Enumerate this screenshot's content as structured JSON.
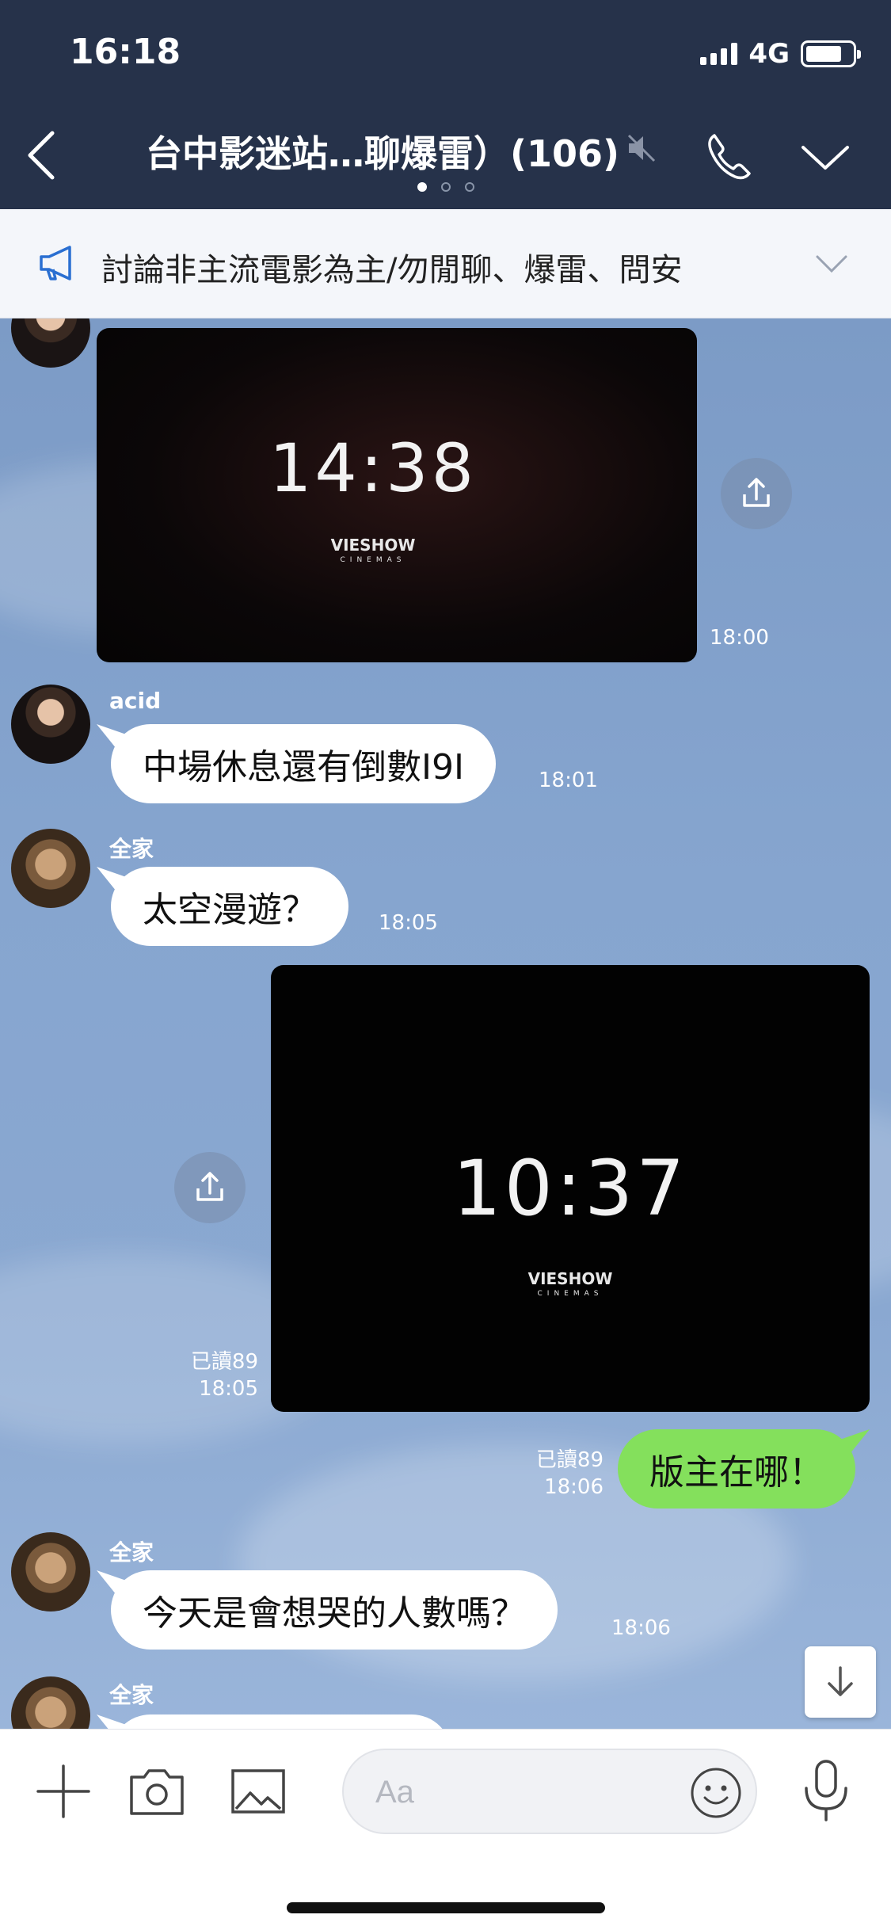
{
  "status_bar": {
    "time": "16:18",
    "network": "4G"
  },
  "header": {
    "title": "台中影迷站…聊爆雷）(106)"
  },
  "announcement": {
    "text": "討論非主流電影為主/勿閒聊、爆雷、問安"
  },
  "messages": [
    {
      "type": "image",
      "clock": "14:38",
      "brand": "VIESHOW",
      "brand_sub": "CINEMAS",
      "time": "18:00"
    },
    {
      "type": "text",
      "sender": "acid",
      "text": "中場休息還有倒數I9I",
      "time": "18:01"
    },
    {
      "type": "text",
      "sender": "全家",
      "text": "太空漫遊？",
      "time": "18:05"
    },
    {
      "type": "image_sent",
      "clock": "10:37",
      "brand": "VIESHOW",
      "brand_sub": "CINEMAS",
      "read": "已讀89",
      "time": "18:05"
    },
    {
      "type": "text_sent",
      "text": "版主在哪！",
      "read": "已讀89",
      "time": "18:06"
    },
    {
      "type": "text",
      "sender": "全家",
      "text": "今天是會想哭的人數嗎？",
      "time": "18:06"
    },
    {
      "type": "text",
      "sender": "全家"
    }
  ],
  "input": {
    "placeholder": "Aa"
  },
  "colors": {
    "header_bg": "#26324a",
    "sent_bubble": "#84e05c",
    "chat_bg": "#86a5cf"
  }
}
